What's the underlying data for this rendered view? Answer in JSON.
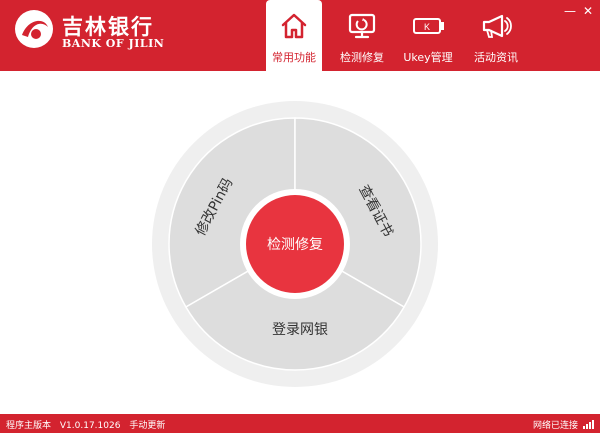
{
  "brand": {
    "name_cn": "吉林银行",
    "name_en": "BANK OF JILIN"
  },
  "nav": [
    {
      "label": "常用功能",
      "icon": "home-icon",
      "active": true
    },
    {
      "label": "检测修复",
      "icon": "monitor-repair-icon",
      "active": false
    },
    {
      "label": "Ukey管理",
      "icon": "ukey-icon",
      "active": false
    },
    {
      "label": "活动资讯",
      "icon": "megaphone-icon",
      "active": false
    }
  ],
  "ukey_glyph": "K",
  "window": {
    "minimize": "—",
    "close": "✕"
  },
  "wheel": {
    "center_label": "检测修复",
    "segments": {
      "top_left": "修改Pin码",
      "top_right": "查看证书",
      "bottom": "登录网银"
    }
  },
  "footer": {
    "version_label": "程序主版本",
    "version": "V1.0.17.1026",
    "update": "手动更新",
    "network_status": "网络已连接"
  },
  "colors": {
    "brand_red": "#d3232f",
    "center_red": "#e8343f",
    "segment_gray": "#dddddd",
    "ring_gray": "#efefef"
  }
}
